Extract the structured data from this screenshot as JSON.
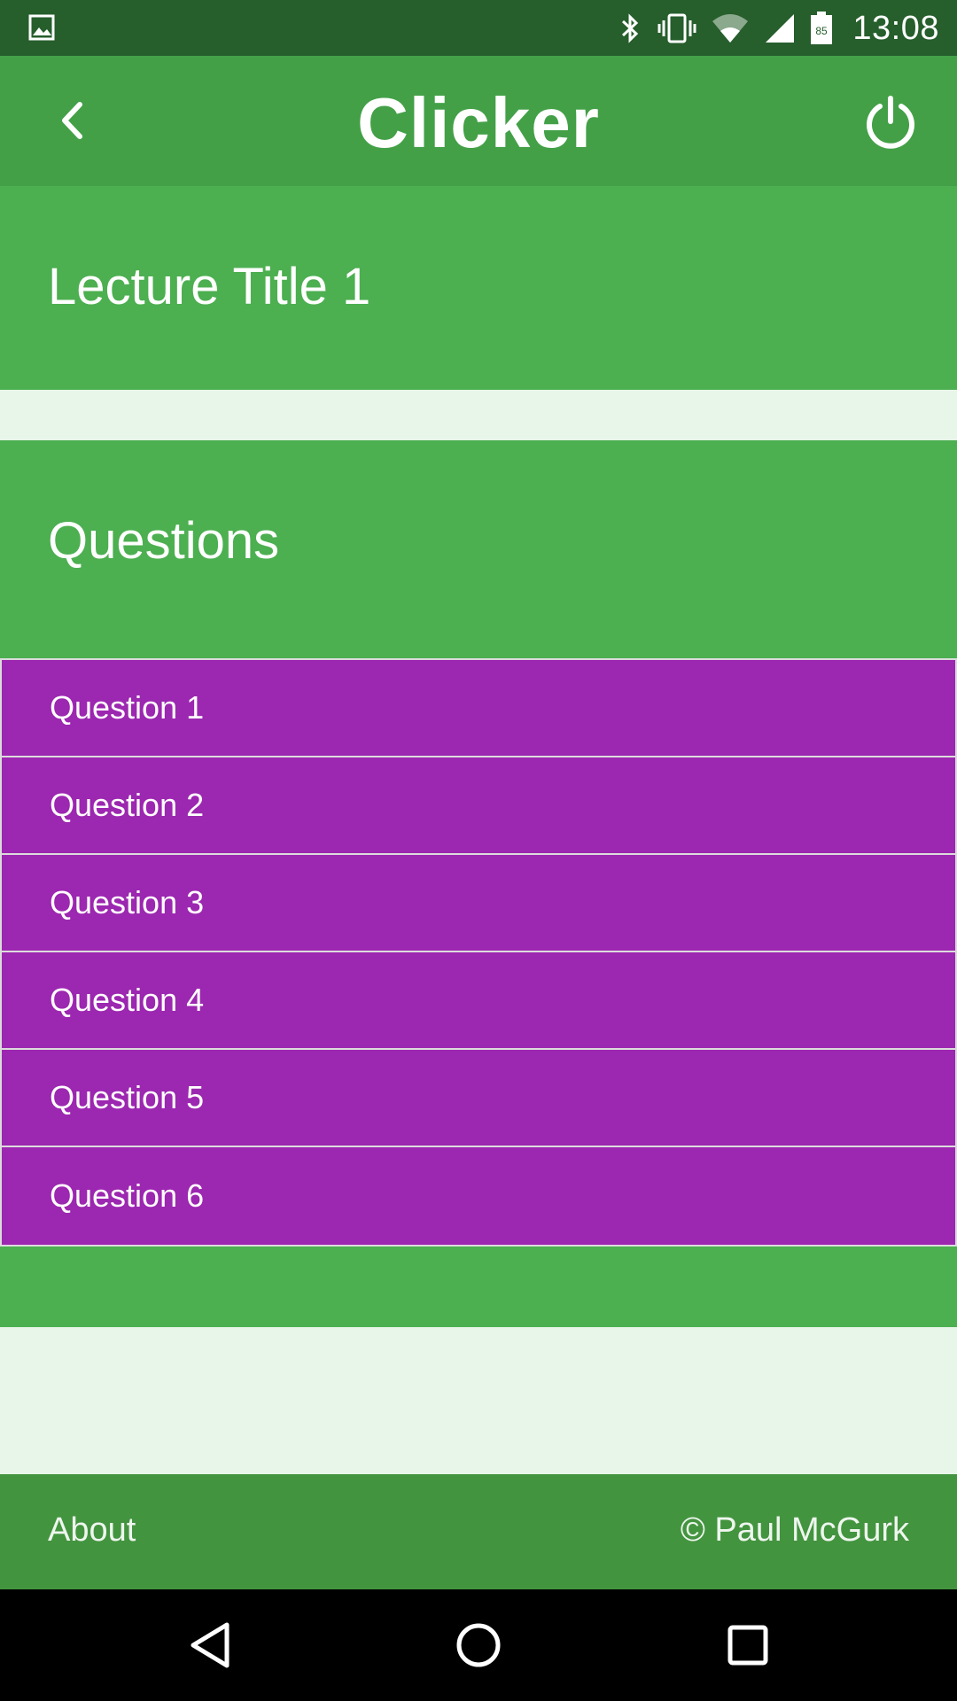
{
  "status_bar": {
    "time": "13:08",
    "battery_level": "85",
    "icons": [
      "image-icon",
      "bluetooth-icon",
      "vibrate-icon",
      "wifi-icon",
      "signal-icon",
      "battery-icon"
    ]
  },
  "app_bar": {
    "title": "Clicker",
    "back_icon": "chevron-left-icon",
    "power_icon": "power-icon"
  },
  "lecture": {
    "title": "Lecture Title 1"
  },
  "questions": {
    "heading": "Questions",
    "items": [
      {
        "label": "Question 1"
      },
      {
        "label": "Question 2"
      },
      {
        "label": "Question 3"
      },
      {
        "label": "Question 4"
      },
      {
        "label": "Question 5"
      },
      {
        "label": "Question 6"
      }
    ]
  },
  "footer": {
    "about": "About",
    "copyright": "© Paul McGurk"
  },
  "nav_bar": {
    "icons": [
      "back-triangle-icon",
      "home-circle-icon",
      "recents-square-icon"
    ]
  },
  "colors": {
    "status_bar": "#265e2c",
    "app_bar": "#43a047",
    "card": "#4caf50",
    "question_item": "#9c27b0",
    "background": "#e8f5e9",
    "footer": "#43943f"
  }
}
